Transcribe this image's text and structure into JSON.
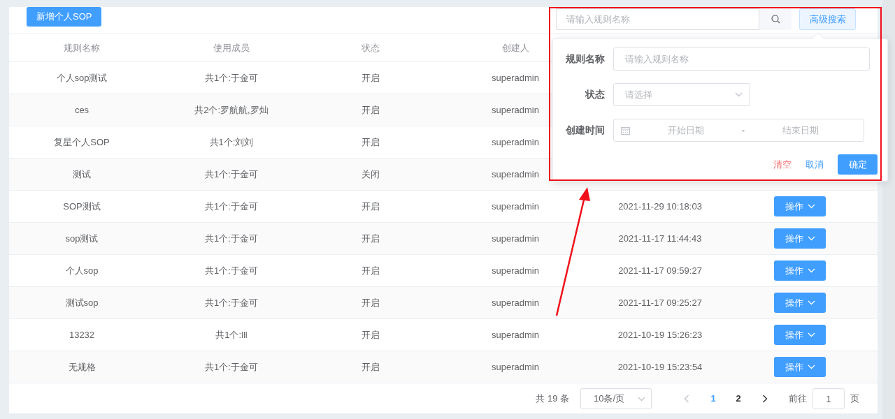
{
  "toolbar": {
    "add_button": "新增个人SOP",
    "search": {
      "placeholder": "请输入规则名称"
    },
    "advanced_button": "高级搜索"
  },
  "table": {
    "columns": [
      "规则名称",
      "使用成员",
      "状态",
      "创建人"
    ],
    "rows": [
      {
        "name": "个人sop测试",
        "members": "共1个:于金可",
        "status": "开启",
        "creator": "superadmin"
      },
      {
        "name": "ces",
        "members": "共2个:罗航航,罗灿",
        "status": "开启",
        "creator": "superadmin"
      },
      {
        "name": "复星个人SOP",
        "members": "共1个:刘刘",
        "status": "开启",
        "creator": "superadmin"
      },
      {
        "name": "测试",
        "members": "共1个:于金可",
        "status": "关闭",
        "creator": "superadmin"
      },
      {
        "name": "SOP测试",
        "members": "共1个:于金可",
        "status": "开启",
        "creator": "superadmin",
        "created": "2021-11-29 10:18:03",
        "action": "操作"
      },
      {
        "name": "sop测试",
        "members": "共1个:于金可",
        "status": "开启",
        "creator": "superadmin",
        "created": "2021-11-17 11:44:43",
        "action": "操作"
      },
      {
        "name": "个人sop",
        "members": "共1个:于金可",
        "status": "开启",
        "creator": "superadmin",
        "created": "2021-11-17 09:59:27",
        "action": "操作"
      },
      {
        "name": "测试sop",
        "members": "共1个:于金可",
        "status": "开启",
        "creator": "superadmin",
        "created": "2021-11-17 09:25:27",
        "action": "操作"
      },
      {
        "name": "13232",
        "members": "共1个:lll",
        "status": "开启",
        "creator": "superadmin",
        "created": "2021-10-19 15:26:23",
        "action": "操作"
      },
      {
        "name": "无规格",
        "members": "共1个:于金可",
        "status": "开启",
        "creator": "superadmin",
        "created": "2021-10-19 15:23:54",
        "action": "操作"
      }
    ]
  },
  "pagination": {
    "total": "共 19 条",
    "page_size": "10条/页",
    "pages": [
      {
        "label": "1",
        "selected": true
      },
      {
        "label": "2",
        "selected": false
      }
    ],
    "goto_label": "前往",
    "goto_value": "1",
    "goto_suffix": "页"
  },
  "advanced_search": {
    "fields": [
      {
        "kind": "text",
        "label": "规则名称",
        "placeholder": "请输入规则名称"
      },
      {
        "kind": "select",
        "label": "状态",
        "placeholder": "请选择"
      },
      {
        "kind": "daterange",
        "label": "创建时间",
        "start_placeholder": "开始日期",
        "separator": "-",
        "end_placeholder": "结束日期"
      }
    ],
    "buttons": [
      {
        "kind": "danger-link",
        "label": "清空"
      },
      {
        "kind": "link",
        "label": "取消"
      },
      {
        "kind": "primary",
        "label": "确定"
      }
    ]
  }
}
